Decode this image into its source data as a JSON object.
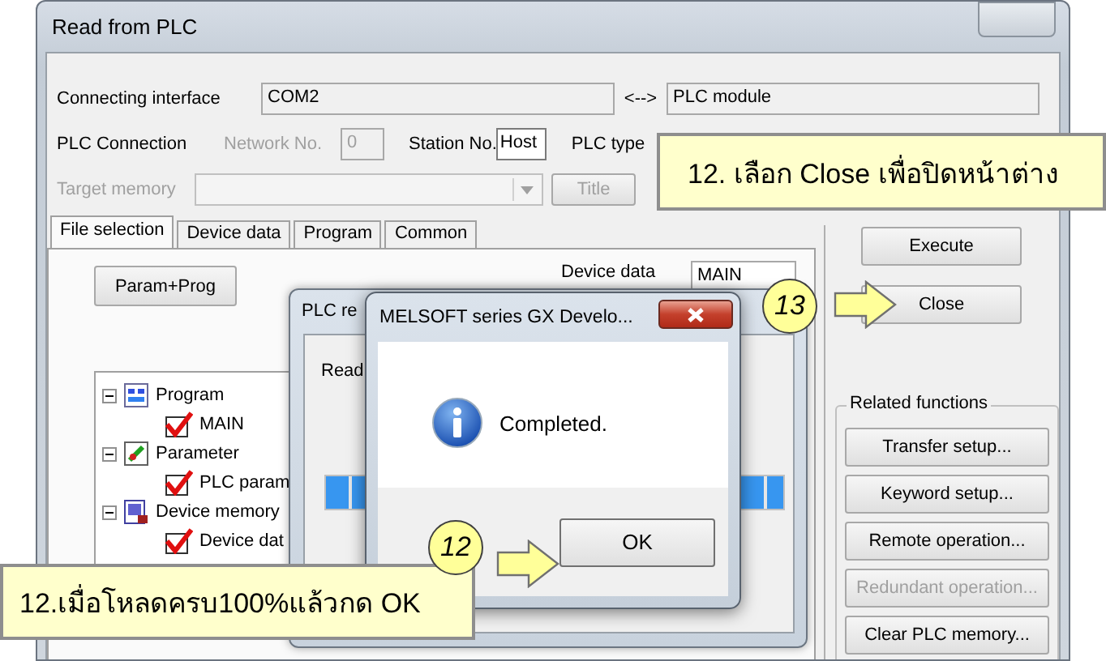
{
  "window": {
    "title": "Read from PLC"
  },
  "connection": {
    "interface_label": "Connecting interface",
    "interface_value": "COM2",
    "link": "<-->",
    "module_value": "PLC module"
  },
  "plc_connection": {
    "label": "PLC Connection",
    "network_label": "Network No.",
    "network_value": "0",
    "network_disabled": true,
    "station_label": "Station No.",
    "station_value": "Host",
    "plc_type_label": "PLC type"
  },
  "target_memory": {
    "label": "Target memory",
    "disabled": true,
    "title_button": "Title"
  },
  "tabs": [
    {
      "label": "File selection",
      "selected": true
    },
    {
      "label": "Device data",
      "selected": false
    },
    {
      "label": "Program",
      "selected": false
    },
    {
      "label": "Common",
      "selected": false
    }
  ],
  "file_selection": {
    "param_prog_button": "Param+Prog",
    "device_data_label": "Device data",
    "device_data_value": "MAIN",
    "tree": [
      {
        "label": "Program",
        "kind": "program",
        "expanded": true,
        "children": [
          {
            "label": "MAIN",
            "checked": true
          }
        ]
      },
      {
        "label": "Parameter",
        "kind": "parameter",
        "expanded": true,
        "children": [
          {
            "label": "PLC param",
            "checked": true
          }
        ]
      },
      {
        "label": "Device memory",
        "kind": "device",
        "expanded": true,
        "children": [
          {
            "label": "Device dat",
            "checked": true
          }
        ]
      }
    ]
  },
  "actions": [
    {
      "label": "Execute"
    },
    {
      "label": "Close"
    }
  ],
  "related_functions": {
    "title": "Related functions",
    "buttons": [
      {
        "label": "Transfer setup...",
        "disabled": false
      },
      {
        "label": "Keyword setup...",
        "disabled": false
      },
      {
        "label": "Remote operation...",
        "disabled": false
      },
      {
        "label": "Redundant operation...",
        "disabled": true
      },
      {
        "label": "Clear PLC memory...",
        "disabled": false
      }
    ]
  },
  "progress_dialog": {
    "title": "PLC re",
    "text": "Read",
    "level": 1
  },
  "message_box": {
    "title": "MELSOFT series GX Develo...",
    "message": "Completed.",
    "button": "OK"
  },
  "callouts": [
    {
      "text": "12. เลือก Close เพื่อปิดหน้าต่าง"
    },
    {
      "text": "12.เมื่อโหลดครบ100%แล้วกด OK"
    }
  ],
  "steps": [
    {
      "number": "13"
    },
    {
      "number": "12"
    }
  ]
}
